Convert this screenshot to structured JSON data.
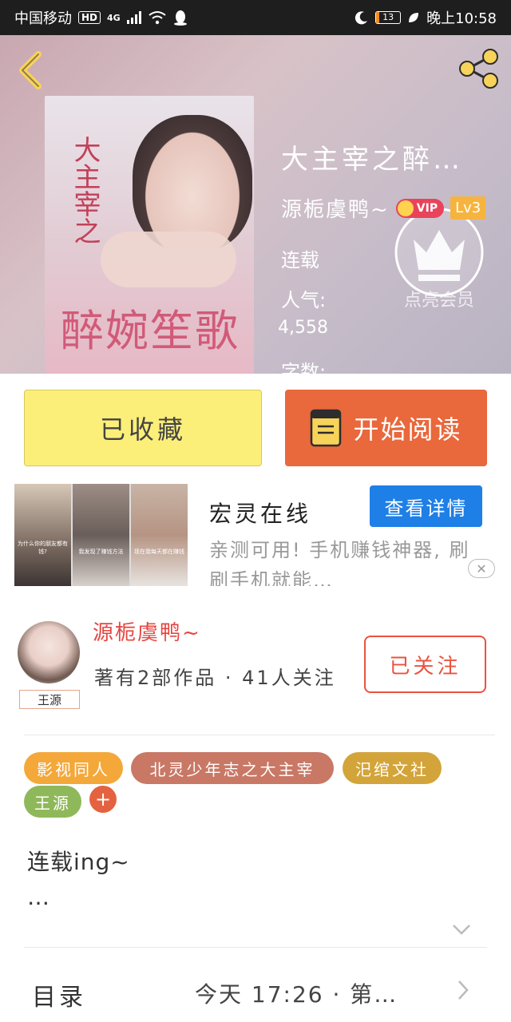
{
  "status_bar": {
    "carrier": "中国移动",
    "hd": "HD",
    "network": "4G",
    "battery": "13",
    "battery_level": 0.13,
    "time": "晚上10:58"
  },
  "book": {
    "title": "大主宰之醉…",
    "author": "源栀虞鸭~",
    "vip": "VIP",
    "level": "Lv3",
    "status": "连载",
    "popularity_label": "人气:",
    "popularity_value": "4,558",
    "light_member": "点亮会员",
    "word_count_label": "字数:",
    "cover_vertical_text": "大主宰之",
    "cover_title": "醉婉笙歌"
  },
  "actions": {
    "collect_label": "已收藏",
    "read_label": "开始阅读"
  },
  "ad": {
    "title": "宏灵在线",
    "detail_button": "查看详情",
    "description": "亲测可用!  手机赚钱神器,  刷刷手机就能…",
    "close_symbol": "✕",
    "captions": [
      "为什么你的朋友都有钱?",
      "我发现了赚钱方法",
      "现在我每天都在赚钱"
    ]
  },
  "author_card": {
    "name": "源栀虞鸭~",
    "meta": "著有2部作品 · 41人关注",
    "avatar_tag": "王源",
    "follow_button": "已关注"
  },
  "tags": [
    {
      "label": "影视同人",
      "color": "#f4a83a"
    },
    {
      "label": "北灵少年志之大主宰",
      "color": "#c97866"
    },
    {
      "label": "汜绾文社",
      "color": "#d3a43a"
    },
    {
      "label": "王源",
      "color": "#8fb85a"
    }
  ],
  "tag_add": "+",
  "intro": {
    "text": "连载ing~",
    "ellipsis": "…"
  },
  "toc": {
    "label": "目录",
    "update": "今天 17:26 · 第…"
  },
  "colors": {
    "accent_orange": "#e9683c",
    "accent_red": "#e6453f",
    "collect_yellow": "#fbef7a",
    "ad_blue": "#1e7fe6"
  }
}
